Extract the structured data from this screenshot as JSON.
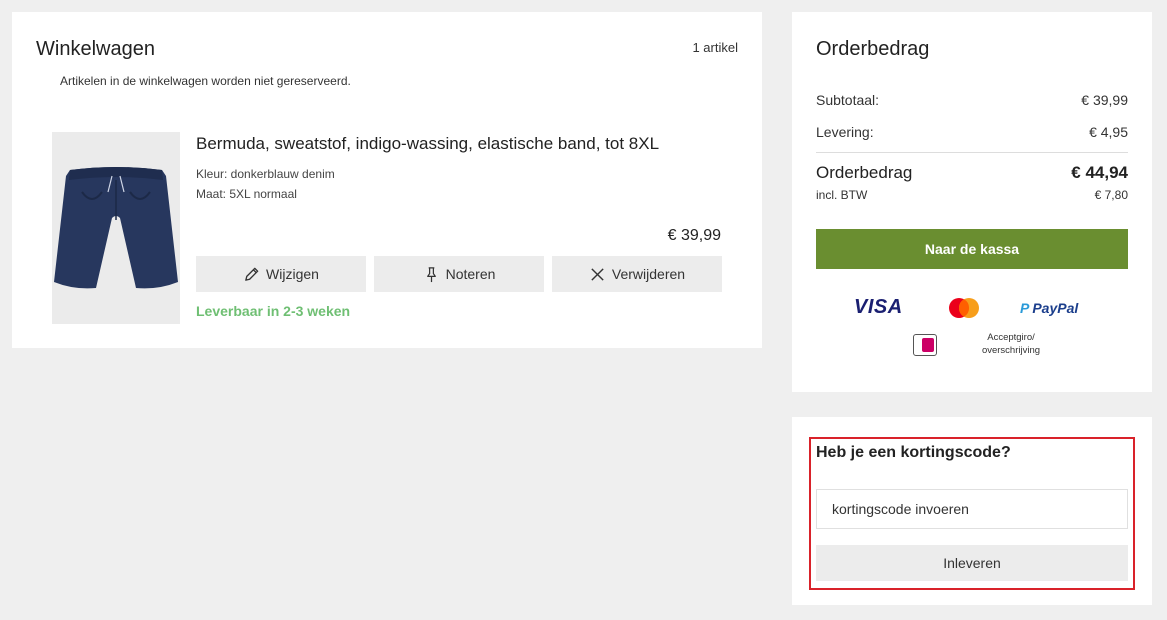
{
  "cart": {
    "title": "Winkelwagen",
    "count": "1 artikel",
    "note": "Artikelen in de winkelwagen worden niet gereserveerd.",
    "item": {
      "name": "Bermuda, sweatstof, indigo-wassing, elastische band, tot 8XL",
      "color": "Kleur: donkerblauw denim",
      "size": "Maat: 5XL normaal",
      "price": "€ 39,99",
      "availability": "Leverbaar in 2-3 weken",
      "image_icon": "shorts-product-image",
      "actions": {
        "edit": "Wijzigen",
        "note": "Noteren",
        "remove": "Verwijderen"
      }
    }
  },
  "summary": {
    "title": "Orderbedrag",
    "subtotal_label": "Subtotaal:",
    "subtotal_value": "€ 39,99",
    "delivery_label": "Levering:",
    "delivery_value": "€ 4,95",
    "total_label": "Orderbedrag",
    "total_value": "€ 44,94",
    "vat_label": "incl. BTW",
    "vat_value": "€ 7,80",
    "checkout_label": "Naar de kassa",
    "payment": {
      "visa": "VISA",
      "paypal": "PayPal",
      "transfer": "Acceptgiro/ overschrijving"
    }
  },
  "discount": {
    "title": "Heb je een kortingscode?",
    "placeholder": "kortingscode invoeren",
    "submit_label": "Inleveren"
  },
  "colors": {
    "checkout": "#6a8e30",
    "availability": "#6fbf73",
    "highlight_frame": "#d9222a"
  }
}
